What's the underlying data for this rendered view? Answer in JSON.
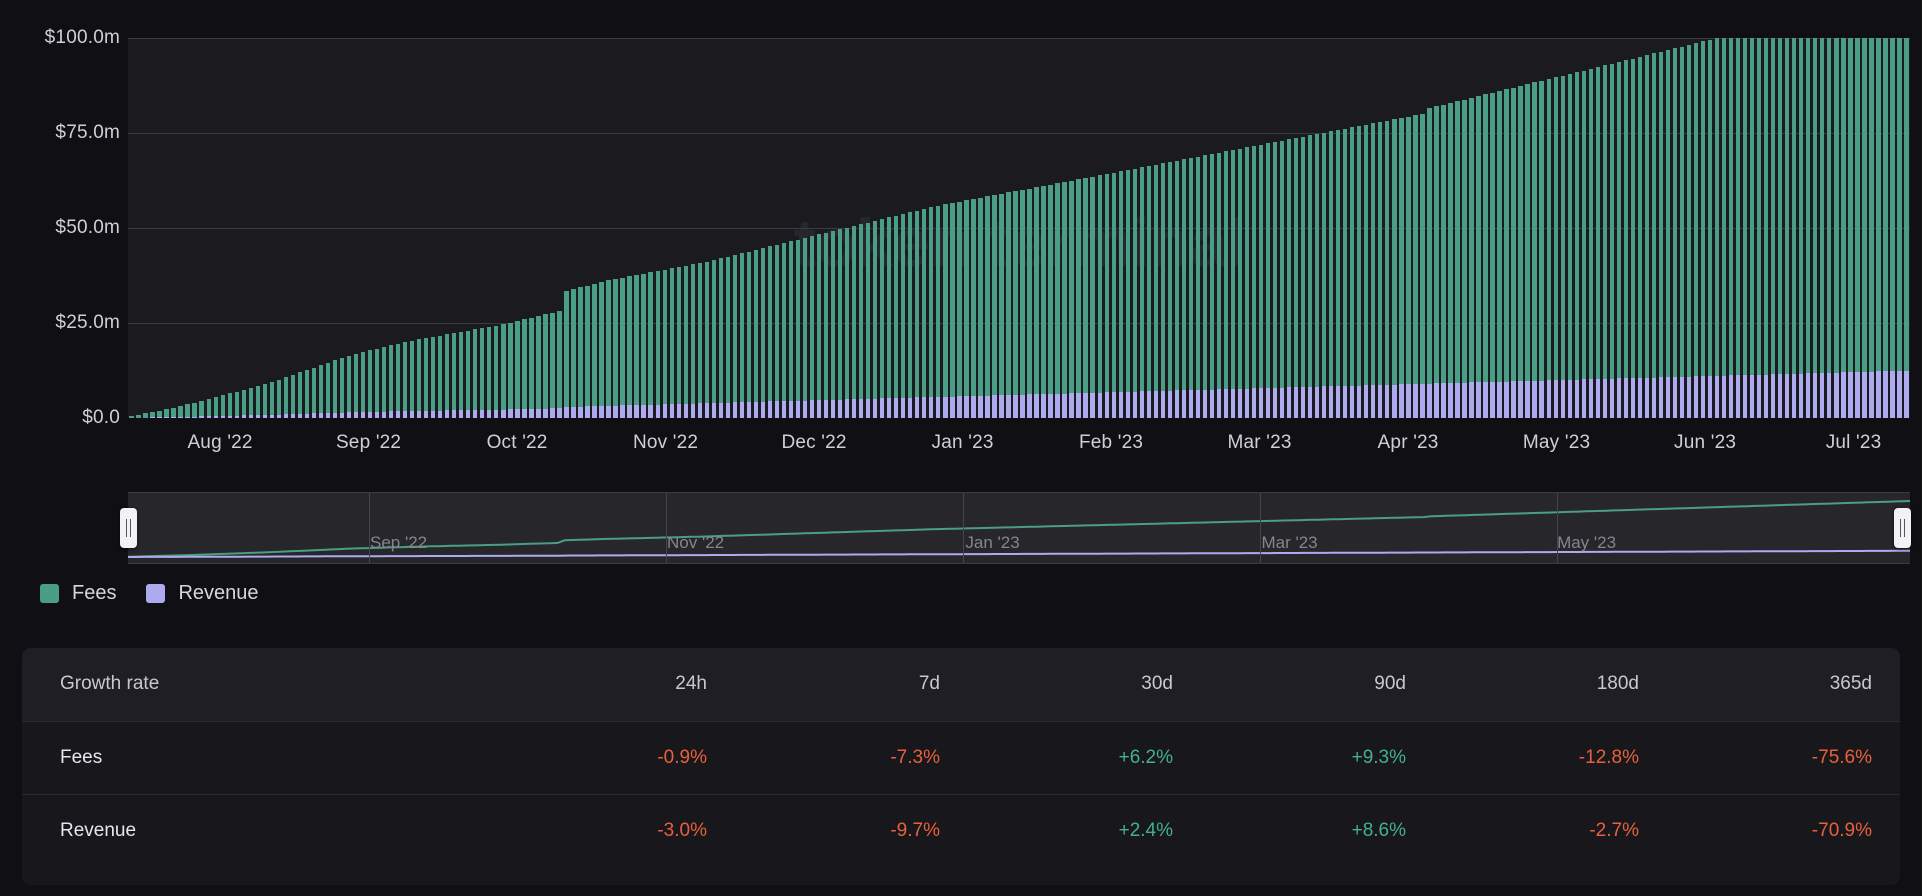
{
  "watermark": "token terminal",
  "colors": {
    "fees": "#4a9e85",
    "revenue": "#aeaaf0",
    "positive": "#45b08e",
    "negative": "#e8613c",
    "background": "#101014",
    "plot_background": "#1a1a1f"
  },
  "legend": {
    "items": [
      {
        "label": "Fees",
        "color": "#4a9e85",
        "name": "legend-item-fees"
      },
      {
        "label": "Revenue",
        "color": "#aeaaf0",
        "name": "legend-item-revenue"
      }
    ]
  },
  "range_selector": {
    "labels": [
      "Sep '22",
      "Nov '22",
      "Jan '23",
      "Mar '23",
      "May '23"
    ],
    "left_handle": "range-handle-left",
    "right_handle": "range-handle-right"
  },
  "table": {
    "headers": [
      "Growth rate",
      "24h",
      "7d",
      "30d",
      "90d",
      "180d",
      "365d"
    ],
    "rows": [
      {
        "label": "Fees",
        "values": [
          "-0.9%",
          "-7.3%",
          "+6.2%",
          "+9.3%",
          "-12.8%",
          "-75.6%"
        ],
        "signs": [
          "neg",
          "neg",
          "pos",
          "pos",
          "neg",
          "neg"
        ]
      },
      {
        "label": "Revenue",
        "values": [
          "-3.0%",
          "-9.7%",
          "+2.4%",
          "+8.6%",
          "-2.7%",
          "-70.9%"
        ],
        "signs": [
          "neg",
          "neg",
          "pos",
          "pos",
          "neg",
          "neg"
        ]
      }
    ]
  },
  "chart_data": {
    "type": "bar",
    "stacked": true,
    "title": "",
    "xlabel": "",
    "ylabel": "",
    "ylim": [
      0,
      100
    ],
    "ytick_labels": [
      "$100.0m",
      "$75.0m",
      "$50.0m",
      "$25.0m",
      "$0.0"
    ],
    "ytick_values": [
      100,
      75,
      50,
      25,
      0
    ],
    "unit": "USD millions",
    "grid": true,
    "legend_position": "bottom-left",
    "xtick_labels": [
      "Aug '22",
      "Sep '22",
      "Oct '22",
      "Nov '22",
      "Dec '22",
      "Jan '23",
      "Feb '23",
      "Mar '23",
      "Apr '23",
      "May '23",
      "Jun '23",
      "Jul '23"
    ],
    "x_start": "2022-07-14",
    "x_end": "2023-07-08",
    "series": [
      {
        "name": "Fees",
        "color": "#4a9e85",
        "values": [
          0.5,
          0.8,
          1.1,
          1.4,
          1.8,
          2.1,
          2.5,
          2.9,
          3.3,
          3.7,
          4.1,
          4.6,
          5.0,
          5.4,
          5.9,
          6.3,
          6.8,
          7.2,
          7.7,
          8.2,
          8.7,
          9.2,
          9.8,
          10.3,
          10.9,
          11.4,
          12.0,
          12.6,
          13.2,
          13.8,
          14.4,
          14.9,
          15.4,
          15.8,
          16.2,
          16.6,
          17.0,
          17.4,
          17.8,
          18.1,
          18.5,
          18.8,
          19.1,
          19.4,
          19.7,
          20.0,
          20.3,
          20.6,
          20.9,
          21.2,
          21.5,
          21.8,
          22.1,
          22.4,
          22.8,
          23.2,
          23.6,
          24.0,
          24.4,
          24.8,
          25.2,
          25.6,
          30.5,
          31.0,
          31.4,
          31.8,
          32.2,
          32.6,
          33.0,
          33.3,
          33.6,
          33.9,
          34.2,
          34.5,
          34.8,
          35.1,
          35.4,
          35.7,
          36.0,
          36.3,
          36.6,
          36.9,
          37.2,
          37.6,
          38.0,
          38.4,
          38.8,
          39.2,
          39.6,
          40.0,
          40.4,
          40.8,
          41.2,
          41.6,
          42.0,
          42.4,
          42.8,
          43.2,
          43.6,
          44.0,
          44.4,
          44.8,
          45.2,
          45.6,
          46.0,
          46.4,
          46.8,
          47.2,
          47.6,
          48.0,
          48.4,
          48.8,
          49.2,
          49.6,
          50.0,
          50.3,
          50.6,
          50.9,
          51.2,
          51.5,
          51.8,
          52.1,
          52.4,
          52.7,
          53.0,
          53.3,
          53.6,
          53.9,
          54.2,
          54.5,
          54.8,
          55.1,
          55.4,
          55.7,
          56.0,
          56.3,
          56.6,
          56.9,
          57.2,
          57.5,
          57.8,
          58.1,
          58.4,
          58.7,
          59.0,
          59.3,
          59.6,
          59.9,
          60.2,
          60.5,
          60.8,
          61.1,
          61.4,
          61.7,
          62.0,
          62.3,
          62.6,
          62.9,
          63.2,
          63.5,
          63.8,
          64.1,
          64.4,
          64.7,
          65.0,
          65.3,
          65.6,
          65.9,
          66.2,
          66.5,
          66.8,
          67.1,
          67.4,
          67.7,
          68.0,
          68.3,
          68.6,
          68.9,
          69.2,
          69.5,
          69.8,
          70.1,
          70.4,
          70.7,
          71.0,
          72.5,
          72.9,
          73.3,
          73.7,
          74.1,
          74.5,
          74.9,
          75.3,
          75.7,
          76.1,
          76.5,
          76.9,
          77.3,
          77.7,
          78.1,
          78.5,
          78.9,
          79.3,
          79.7,
          80.1,
          80.5,
          80.9,
          81.3,
          81.7,
          82.1,
          82.5,
          82.9,
          83.3,
          83.7,
          84.1,
          84.5,
          84.9,
          85.3,
          85.7,
          86.1,
          86.5,
          86.9,
          87.3,
          87.7,
          88.1,
          88.5,
          88.9,
          89.3,
          89.7,
          90.1,
          90.5,
          90.9,
          91.3,
          91.7,
          92.1,
          92.5,
          92.9,
          93.3,
          93.7,
          94.1,
          94.5,
          94.9,
          95.3,
          95.7,
          96.1,
          96.5,
          96.9,
          97.3,
          97.7,
          98.1,
          98.5,
          98.9,
          99.3,
          99.7
        ]
      },
      {
        "name": "Revenue",
        "color": "#aeaaf0",
        "values": [
          0.05,
          0.08,
          0.11,
          0.14,
          0.18,
          0.21,
          0.25,
          0.29,
          0.33,
          0.37,
          0.41,
          0.46,
          0.5,
          0.54,
          0.59,
          0.63,
          0.68,
          0.72,
          0.77,
          0.82,
          0.87,
          0.92,
          0.98,
          1.03,
          1.09,
          1.14,
          1.2,
          1.26,
          1.32,
          1.38,
          1.44,
          1.49,
          1.54,
          1.58,
          1.62,
          1.66,
          1.7,
          1.74,
          1.78,
          1.81,
          1.85,
          1.88,
          1.91,
          1.94,
          1.97,
          2.0,
          2.03,
          2.06,
          2.09,
          2.12,
          2.15,
          2.18,
          2.21,
          2.24,
          2.28,
          2.32,
          2.36,
          2.4,
          2.44,
          2.48,
          2.52,
          2.56,
          2.9,
          2.95,
          3.0,
          3.05,
          3.1,
          3.15,
          3.2,
          3.25,
          3.3,
          3.35,
          3.4,
          3.45,
          3.5,
          3.55,
          3.6,
          3.65,
          3.7,
          3.75,
          3.8,
          3.85,
          3.9,
          3.95,
          4.0,
          4.05,
          4.1,
          4.15,
          4.2,
          4.25,
          4.3,
          4.35,
          4.4,
          4.45,
          4.5,
          4.55,
          4.6,
          4.65,
          4.7,
          4.75,
          4.8,
          4.85,
          4.9,
          4.95,
          5.0,
          5.05,
          5.1,
          5.15,
          5.2,
          5.25,
          5.3,
          5.35,
          5.4,
          5.45,
          5.5,
          5.55,
          5.6,
          5.65,
          5.7,
          5.75,
          5.8,
          5.85,
          5.9,
          5.95,
          6.0,
          6.05,
          6.1,
          6.15,
          6.2,
          6.25,
          6.3,
          6.35,
          6.4,
          6.45,
          6.5,
          6.55,
          6.6,
          6.65,
          6.7,
          6.75,
          6.8,
          6.85,
          6.9,
          6.95,
          7.0,
          7.05,
          7.1,
          7.15,
          7.2,
          7.25,
          7.3,
          7.35,
          7.4,
          7.45,
          7.5,
          7.55,
          7.6,
          7.65,
          7.7,
          7.75,
          7.8,
          7.85,
          7.9,
          7.95,
          8.0,
          8.05,
          8.1,
          8.15,
          8.2,
          8.25,
          8.3,
          8.35,
          8.4,
          8.45,
          8.5,
          8.55,
          8.6,
          8.65,
          8.7,
          8.75,
          8.8,
          8.85,
          8.9,
          8.95,
          9.0,
          9.05,
          9.1,
          9.15,
          9.2,
          9.25,
          9.3,
          9.35,
          9.4,
          9.45,
          9.5,
          9.55,
          9.6,
          9.65,
          9.7,
          9.75,
          9.8,
          9.85,
          9.9,
          9.95,
          10.0,
          10.05,
          10.1,
          10.15,
          10.2,
          10.25,
          10.3,
          10.35,
          10.4,
          10.45,
          10.5,
          10.55,
          10.6,
          10.65,
          10.7,
          10.75,
          10.8,
          10.85,
          10.9,
          10.95,
          11.0,
          11.05,
          11.1,
          11.15,
          11.2,
          11.25,
          11.3,
          11.35,
          11.4,
          11.45,
          11.5,
          11.55,
          11.6,
          11.65,
          11.7,
          11.75,
          11.8,
          11.85,
          11.9,
          11.95,
          12.0,
          12.05,
          12.1,
          12.15,
          12.2,
          12.25,
          12.3,
          12.35,
          12.4,
          12.45,
          12.5,
          12.55,
          12.6,
          12.65
        ]
      }
    ]
  }
}
